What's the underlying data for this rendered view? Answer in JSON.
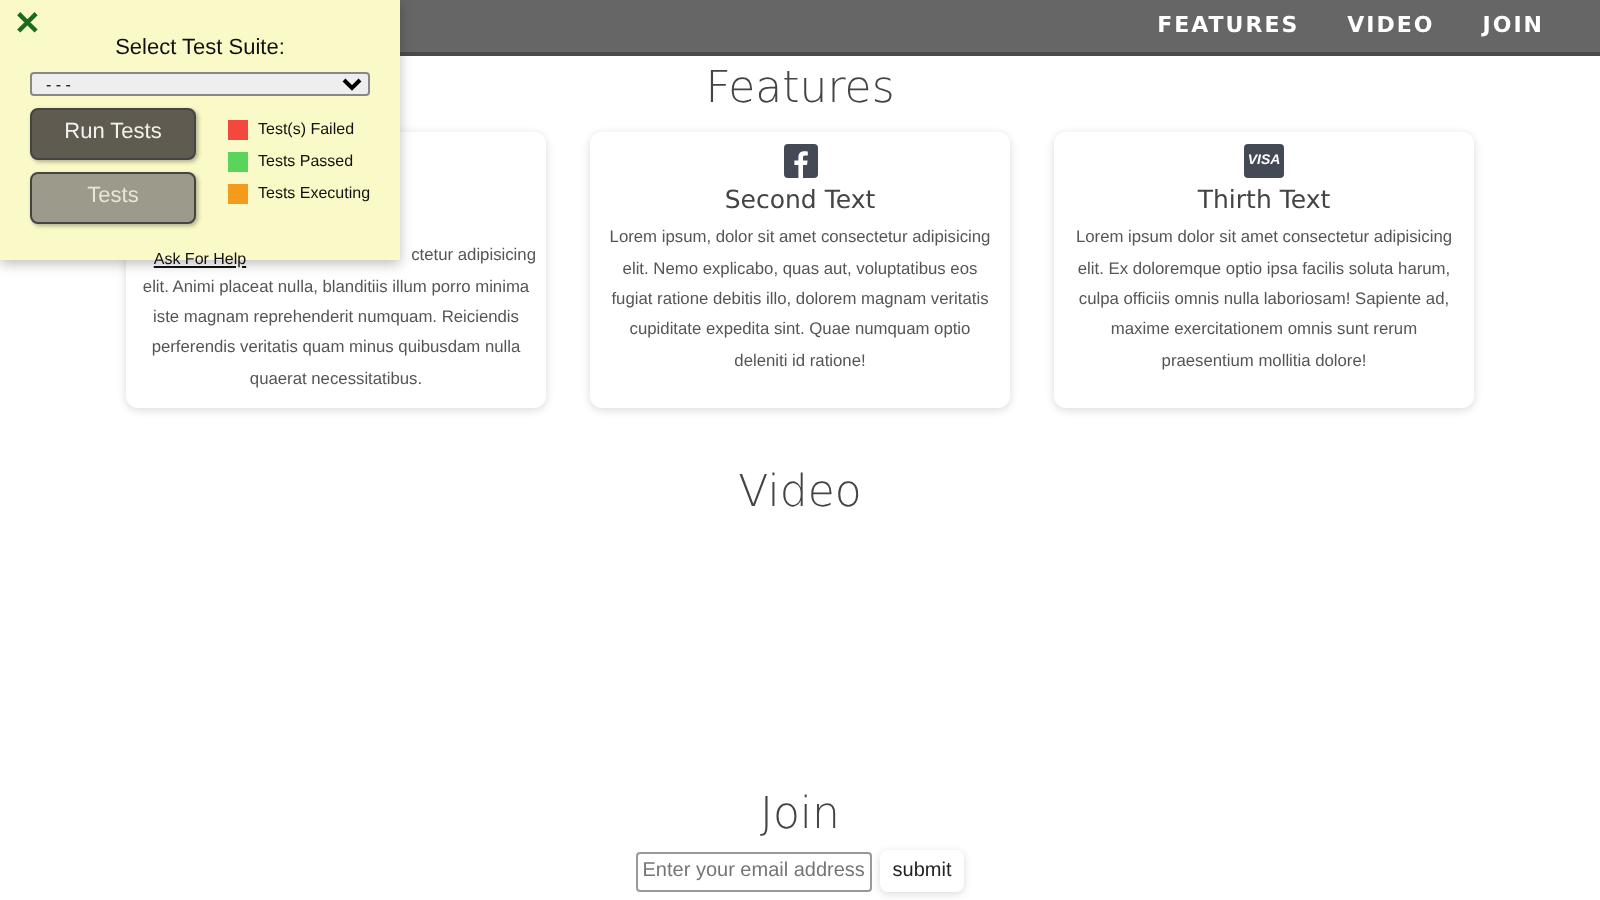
{
  "navbar": {
    "links": [
      "FEATURES",
      "VIDEO",
      "JOIN"
    ]
  },
  "features": {
    "heading": "Features",
    "cards": [
      {
        "kind": "covered",
        "text_fragment": "ctetur adipisicing",
        "text": "elit. Animi placeat nulla, blanditiis illum porro minima iste magnam reprehenderit numquam. Reiciendis perferendis veritatis quam minus quibusdam nulla quaerat necessitatibus."
      },
      {
        "kind": "social",
        "title": "Second Text",
        "text": "Lorem ipsum, dolor sit amet consectetur adipisicing elit. Nemo explicabo, quas aut, voluptatibus eos fugiat ratione debitis illo, dolorem magnam veritatis cupiditate expedita sint. Quae numquam optio deleniti id ratione!"
      },
      {
        "kind": "payment",
        "logo_text": "VISA",
        "title": "Thirth Text",
        "text": "Lorem ipsum dolor sit amet consectetur adipisicing elit. Ex doloremque optio ipsa facilis soluta harum, culpa officiis omnis nulla laboriosam! Sapiente ad, maxime exercitationem omnis sunt rerum praesentium mollitia dolore!"
      }
    ]
  },
  "video": {
    "heading": "Video"
  },
  "join": {
    "heading": "Join",
    "email": {
      "placeholder": "Enter your email address"
    },
    "submit": "submit"
  },
  "test_panel": {
    "close": "✕",
    "label": "Select Test Suite:",
    "suite": "- - -",
    "buttons": [
      {
        "label": "Run Tests",
        "disabled": false
      },
      {
        "label": "Tests",
        "disabled": true
      }
    ],
    "legend": [
      {
        "label": "Test(s) Failed",
        "color": "#f4473d"
      },
      {
        "label": "Tests Passed",
        "color": "#5ad45a"
      },
      {
        "label": "Tests Executing",
        "color": "#f59b1b"
      }
    ],
    "help": "Ask For Help"
  }
}
